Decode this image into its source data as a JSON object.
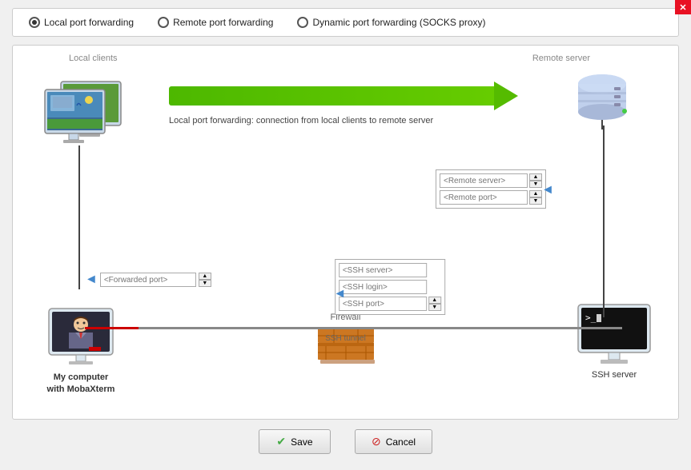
{
  "titlebar": {
    "close_label": "✕"
  },
  "radio_options": [
    {
      "id": "local",
      "label": "Local port forwarding",
      "selected": true
    },
    {
      "id": "remote",
      "label": "Remote port forwarding",
      "selected": false
    },
    {
      "id": "dynamic",
      "label": "Dynamic port forwarding (SOCKS proxy)",
      "selected": false
    }
  ],
  "diagram": {
    "local_clients_label": "Local clients",
    "remote_server_label": "Remote server",
    "description": "Local port forwarding: connection from local clients to remote server",
    "my_computer_label": "My computer\nwith MobaXterm",
    "ssh_server_label": "SSH server",
    "firewall_label": "Firewall",
    "ssh_tunnel_label": "SSH tunnel",
    "inputs": {
      "remote_server_placeholder": "<Remote server>",
      "remote_port_placeholder": "<Remote port>",
      "ssh_server_placeholder": "<SSH server>",
      "ssh_login_placeholder": "<SSH login>",
      "ssh_port_placeholder": "<SSH port>",
      "forwarded_port_placeholder": "<Forwarded port>"
    }
  },
  "buttons": {
    "save_label": "Save",
    "cancel_label": "Cancel",
    "save_icon": "✔",
    "cancel_icon": "🚫"
  }
}
